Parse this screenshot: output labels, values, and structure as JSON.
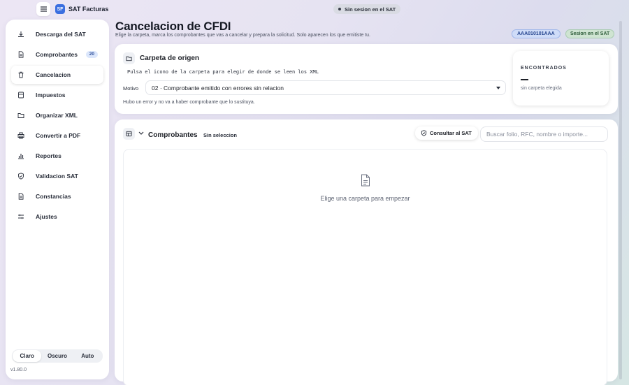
{
  "app": {
    "logo_text": "SF",
    "name": "SAT Facturas"
  },
  "session": {
    "status": "Sin sesion en el SAT"
  },
  "sidebar": {
    "items": [
      {
        "label": "Descarga del SAT",
        "icon": "download-icon"
      },
      {
        "label": "Comprobantes",
        "icon": "document-icon",
        "badge": "20"
      },
      {
        "label": "Cancelacion",
        "icon": "trash-icon",
        "active": true
      },
      {
        "label": "Impuestos",
        "icon": "calculator-icon"
      },
      {
        "label": "Organizar XML",
        "icon": "folder-icon"
      },
      {
        "label": "Convertir a PDF",
        "icon": "printer-icon"
      },
      {
        "label": "Reportes",
        "icon": "bar-chart-icon"
      },
      {
        "label": "Validacion SAT",
        "icon": "shield-check-icon"
      },
      {
        "label": "Constancias",
        "icon": "document-icon"
      },
      {
        "label": "Ajustes",
        "icon": "sliders-icon"
      }
    ],
    "theme": {
      "options": [
        "Claro",
        "Oscuro",
        "Auto"
      ],
      "selected": "Claro"
    },
    "version": "v1.80.0"
  },
  "header": {
    "title": "Cancelacion de CFDI",
    "subtitle": "Elige la carpeta, marca los comprobantes que vas a cancelar y prepara la solicitud. Solo aparecen los que emitiste tu.",
    "rfc": "AAA010101AAA",
    "sat_session": "Sesion en el SAT"
  },
  "origin": {
    "title": "Carpeta de origen",
    "hint": "Pulsa el icono de la carpeta para elegir de donde se leen los XML",
    "motivo_label": "Motivo",
    "motivo_value": "02 · Comprobante emitido con errores sin relacion",
    "motivo_description": "Hubo un error y no va a haber comprobante que lo sustituya.",
    "found": {
      "title": "ENCONTRADOS",
      "value": "—",
      "status": "sin carpeta elegida"
    }
  },
  "comprobantes": {
    "title": "Comprobantes",
    "selection": "Sin seleccion",
    "consult_label": "Consultar al SAT",
    "search_placeholder": "Buscar folio, RFC, nombre o importe...",
    "empty_text": "Elige una carpeta para empezar"
  },
  "colors": {
    "accent": "#3b6fe0",
    "rfc_badge": "#cfdcf8",
    "sat_badge": "#cfe4d2"
  }
}
